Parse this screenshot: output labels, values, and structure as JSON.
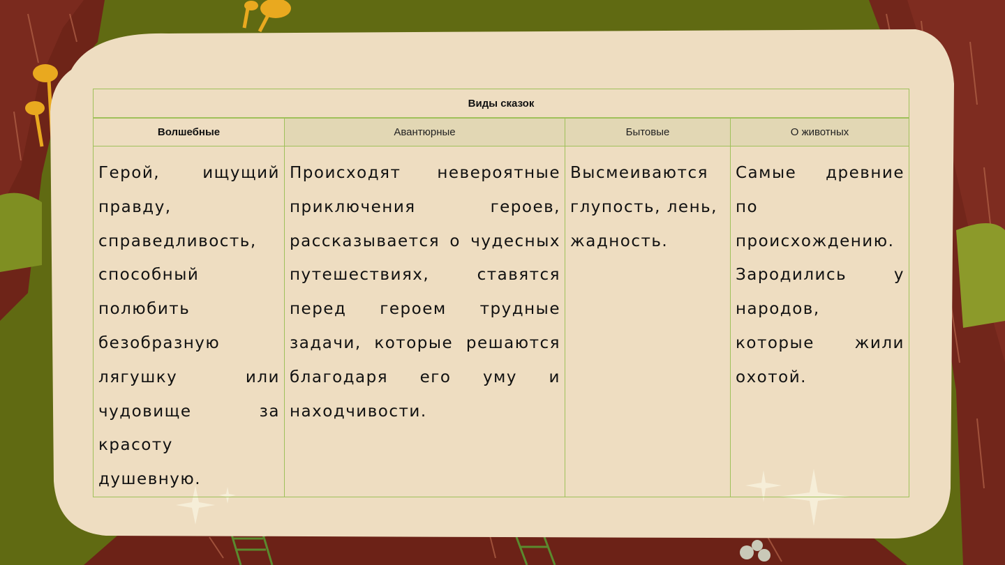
{
  "table": {
    "title": "Виды сказок",
    "headers": [
      "Волшебные",
      "Авантюрные",
      "Бытовые",
      "О животных"
    ],
    "cells": [
      "Герой, ищущий правду, справедливость, способный полюбить безобразную лягушку или чудовище за красоту душевную.",
      "Происходят невероятные приключения героев, рассказывается о чудесных путешествиях, ставятся перед героем трудные задачи, которые решаются благодаря его уму и находчивости.",
      "Высмеиваются глупость, лень, жадность.",
      "Самые древние по происхождению. Зародились у народов, которые жили охотой."
    ]
  },
  "colors": {
    "card": "#eeddc1",
    "border": "#9fc05a",
    "header_fill": "#e2d7b4",
    "background_green": "#5f6a14",
    "background_brown": "#7a2a1e"
  }
}
